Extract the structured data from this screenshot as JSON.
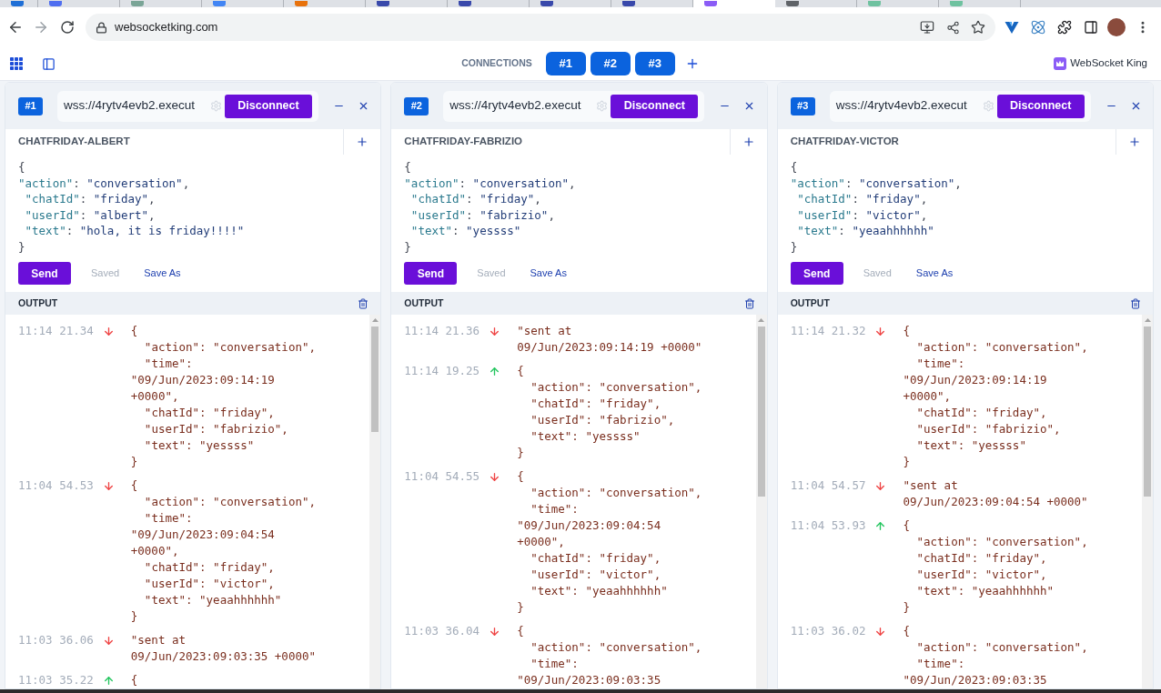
{
  "browser": {
    "tabs": [
      {
        "kind": "pinned",
        "selected": false,
        "color": "#1f6fd6"
      },
      {
        "kind": "tab",
        "selected": false,
        "color": "#4f6ef0"
      },
      {
        "kind": "tab",
        "selected": false,
        "color": "#7aa597"
      },
      {
        "kind": "tab",
        "selected": false,
        "color": "#4285f4"
      },
      {
        "kind": "tab",
        "selected": false,
        "color": "#e8720c"
      },
      {
        "kind": "tab",
        "selected": false,
        "color": "#3949ab"
      },
      {
        "kind": "tab",
        "selected": false,
        "color": "#3949ab"
      },
      {
        "kind": "tab",
        "selected": false,
        "color": "#3949ab"
      },
      {
        "kind": "tab",
        "selected": false,
        "color": "#3949ab"
      },
      {
        "kind": "tab",
        "selected": true,
        "color": "#8b5cf6"
      },
      {
        "kind": "tab",
        "selected": false,
        "color": "#5f6368"
      },
      {
        "kind": "tab",
        "selected": false,
        "color": "#6fc2a0"
      },
      {
        "kind": "tab",
        "selected": false,
        "color": "#6fc2a0"
      }
    ],
    "nav": {
      "back_disabled": false,
      "forward_disabled": true
    },
    "url": "websocketking.com"
  },
  "header": {
    "label": "CONNECTIONS",
    "connections": [
      {
        "label": "#1"
      },
      {
        "label": "#2"
      },
      {
        "label": "#3"
      }
    ],
    "brand": "WebSocket King"
  },
  "panels": [
    {
      "badge": "#1",
      "url": "wss://4rytv4evb2.execut",
      "connect_button": "Disconnect",
      "title": "CHATFRIDAY-ALBERT",
      "editor": "{\n\"action\": \"conversation\",\n \"chatId\": \"friday\",\n \"userId\": \"albert\",\n \"text\": \"hola, it is friday!!!!\"\n}",
      "send_button": "Send",
      "saved_button": {
        "label": "Saved",
        "disabled": true
      },
      "save_as_link": "Save As",
      "output_label": "OUTPUT",
      "messages": [
        {
          "time": "11:14 21.34",
          "kind": "incoming",
          "text": "{\n  \"action\": \"conversation\",\n  \"time\": \"09/Jun/2023:09:14:19 +0000\",\n  \"chatId\": \"friday\",\n  \"userId\": \"fabrizio\",\n  \"text\": \"yessss\"\n}"
        },
        {
          "time": "11:04 54.53",
          "kind": "incoming",
          "text": "{\n  \"action\": \"conversation\",\n  \"time\": \"09/Jun/2023:09:04:54 +0000\",\n  \"chatId\": \"friday\",\n  \"userId\": \"victor\",\n  \"text\": \"yeaahhhhhh\"\n}"
        },
        {
          "time": "11:03 36.06",
          "kind": "incoming",
          "text": "\"sent at 09/Jun/2023:09:03:35 +0000\""
        },
        {
          "time": "11:03 35.22",
          "kind": "outgoing",
          "text": "{"
        }
      ]
    },
    {
      "badge": "#2",
      "url": "wss://4rytv4evb2.execut",
      "connect_button": "Disconnect",
      "title": "CHATFRIDAY-FABRIZIO",
      "editor": "{\n\"action\": \"conversation\",\n \"chatId\": \"friday\",\n \"userId\": \"fabrizio\",\n \"text\": \"yessss\"\n}",
      "send_button": "Send",
      "saved_button": {
        "label": "Saved",
        "disabled": true
      },
      "save_as_link": "Save As",
      "output_label": "OUTPUT",
      "messages": [
        {
          "time": "11:14 21.36",
          "kind": "incoming",
          "text": "\"sent at 09/Jun/2023:09:14:19 +0000\""
        },
        {
          "time": "11:14 19.25",
          "kind": "outgoing",
          "text": "{\n  \"action\": \"conversation\",\n  \"chatId\": \"friday\",\n  \"userId\": \"fabrizio\",\n  \"text\": \"yessss\"\n}"
        },
        {
          "time": "11:04 54.55",
          "kind": "incoming",
          "text": "{\n  \"action\": \"conversation\",\n  \"time\": \"09/Jun/2023:09:04:54 +0000\",\n  \"chatId\": \"friday\",\n  \"userId\": \"victor\",\n  \"text\": \"yeaahhhhhh\"\n}"
        },
        {
          "time": "11:03 36.04",
          "kind": "incoming",
          "text": "{\n  \"action\": \"conversation\",\n  \"time\": \"09/Jun/2023:09:03:35"
        }
      ]
    },
    {
      "badge": "#3",
      "url": "wss://4rytv4evb2.execut",
      "connect_button": "Disconnect",
      "title": "CHATFRIDAY-VICTOR",
      "editor": "{\n\"action\": \"conversation\",\n \"chatId\": \"friday\",\n \"userId\": \"victor\",\n \"text\": \"yeaahhhhhh\"\n}",
      "send_button": "Send",
      "saved_button": {
        "label": "Saved",
        "disabled": true
      },
      "save_as_link": "Save As",
      "output_label": "OUTPUT",
      "messages": [
        {
          "time": "11:14 21.32",
          "kind": "incoming",
          "text": "{\n  \"action\": \"conversation\",\n  \"time\": \"09/Jun/2023:09:14:19 +0000\",\n  \"chatId\": \"friday\",\n  \"userId\": \"fabrizio\",\n  \"text\": \"yessss\"\n}"
        },
        {
          "time": "11:04 54.57",
          "kind": "incoming",
          "text": "\"sent at 09/Jun/2023:09:04:54 +0000\""
        },
        {
          "time": "11:04 53.93",
          "kind": "outgoing",
          "text": "{\n  \"action\": \"conversation\",\n  \"chatId\": \"friday\",\n  \"userId\": \"victor\",\n  \"text\": \"yeaahhhhhh\"\n}"
        },
        {
          "time": "11:03 36.02",
          "kind": "incoming",
          "text": "{\n  \"action\": \"conversation\",\n  \"time\": \"09/Jun/2023:09:03:35"
        }
      ]
    }
  ]
}
